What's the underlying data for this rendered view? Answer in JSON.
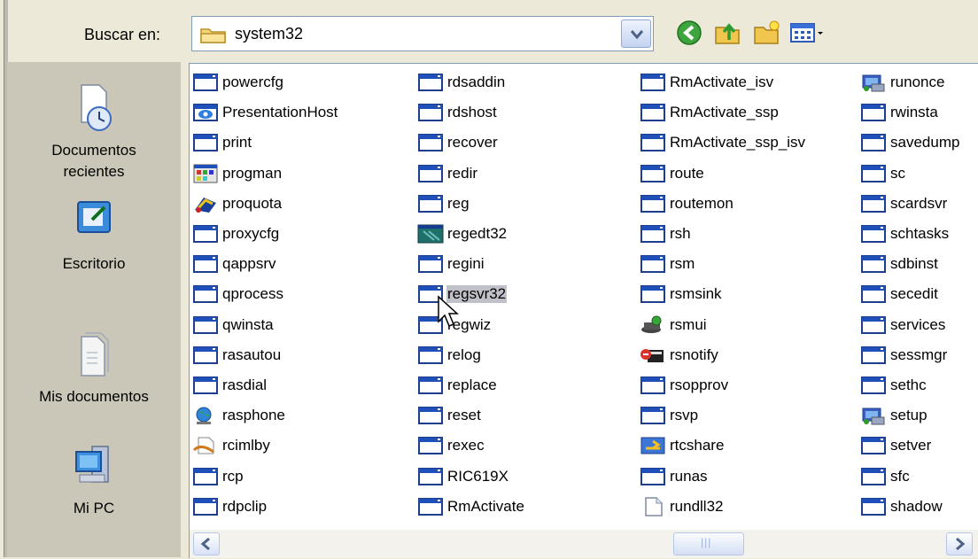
{
  "look_in": {
    "label": "Buscar en:",
    "value": "system32"
  },
  "toolbar": {
    "back_icon": "back-icon",
    "up_icon": "up-folder-icon",
    "new_folder_icon": "new-folder-icon",
    "views_icon": "views-menu-icon"
  },
  "places": [
    {
      "label1": "Documentos",
      "label2": "recientes",
      "icon": "recent-documents-icon"
    },
    {
      "label1": "Escritorio",
      "label2": "",
      "icon": "desktop-icon"
    },
    {
      "label1": "Mis documentos",
      "label2": "",
      "icon": "my-documents-icon"
    },
    {
      "label1": "Mi PC",
      "label2": "",
      "icon": "my-computer-icon"
    }
  ],
  "columns": [
    [
      {
        "name": "powercfg",
        "icon": "exe"
      },
      {
        "name": "PresentationHost",
        "icon": "presentation"
      },
      {
        "name": "print",
        "icon": "exe"
      },
      {
        "name": "progman",
        "icon": "progman"
      },
      {
        "name": "proquota",
        "icon": "proquota"
      },
      {
        "name": "proxycfg",
        "icon": "exe"
      },
      {
        "name": "qappsrv",
        "icon": "exe"
      },
      {
        "name": "qprocess",
        "icon": "exe"
      },
      {
        "name": "qwinsta",
        "icon": "exe"
      },
      {
        "name": "rasautou",
        "icon": "exe"
      },
      {
        "name": "rasdial",
        "icon": "exe"
      },
      {
        "name": "rasphone",
        "icon": "globe"
      },
      {
        "name": "rcimlby",
        "icon": "rcimlby"
      },
      {
        "name": "rcp",
        "icon": "exe"
      },
      {
        "name": "rdpclip",
        "icon": "exe"
      }
    ],
    [
      {
        "name": "rdsaddin",
        "icon": "exe"
      },
      {
        "name": "rdshost",
        "icon": "exe"
      },
      {
        "name": "recover",
        "icon": "exe"
      },
      {
        "name": "redir",
        "icon": "exe"
      },
      {
        "name": "reg",
        "icon": "exe"
      },
      {
        "name": "regedt32",
        "icon": "regedit"
      },
      {
        "name": "regini",
        "icon": "exe"
      },
      {
        "name": "regsvr32",
        "icon": "exe",
        "selected": true
      },
      {
        "name": "regwiz",
        "icon": "exe"
      },
      {
        "name": "relog",
        "icon": "exe"
      },
      {
        "name": "replace",
        "icon": "exe"
      },
      {
        "name": "reset",
        "icon": "exe"
      },
      {
        "name": "rexec",
        "icon": "exe"
      },
      {
        "name": "RIC619X",
        "icon": "exe"
      },
      {
        "name": "RmActivate",
        "icon": "exe"
      }
    ],
    [
      {
        "name": "RmActivate_isv",
        "icon": "exe"
      },
      {
        "name": "RmActivate_ssp",
        "icon": "exe"
      },
      {
        "name": "RmActivate_ssp_isv",
        "icon": "exe"
      },
      {
        "name": "route",
        "icon": "exe"
      },
      {
        "name": "routemon",
        "icon": "exe"
      },
      {
        "name": "rsh",
        "icon": "exe"
      },
      {
        "name": "rsm",
        "icon": "exe"
      },
      {
        "name": "rsmsink",
        "icon": "exe"
      },
      {
        "name": "rsmui",
        "icon": "rsmui"
      },
      {
        "name": "rsnotify",
        "icon": "rsnotify"
      },
      {
        "name": "rsopprov",
        "icon": "exe"
      },
      {
        "name": "rsvp",
        "icon": "exe"
      },
      {
        "name": "rtcshare",
        "icon": "rtcshare"
      },
      {
        "name": "runas",
        "icon": "exe"
      },
      {
        "name": "rundll32",
        "icon": "doc"
      }
    ],
    [
      {
        "name": "runonce",
        "icon": "setup"
      },
      {
        "name": "rwinsta",
        "icon": "exe"
      },
      {
        "name": "savedump",
        "icon": "exe"
      },
      {
        "name": "sc",
        "icon": "exe"
      },
      {
        "name": "scardsvr",
        "icon": "exe"
      },
      {
        "name": "schtasks",
        "icon": "exe"
      },
      {
        "name": "sdbinst",
        "icon": "exe"
      },
      {
        "name": "secedit",
        "icon": "exe"
      },
      {
        "name": "services",
        "icon": "exe"
      },
      {
        "name": "sessmgr",
        "icon": "exe"
      },
      {
        "name": "sethc",
        "icon": "exe"
      },
      {
        "name": "setup",
        "icon": "setup"
      },
      {
        "name": "setver",
        "icon": "exe"
      },
      {
        "name": "sfc",
        "icon": "exe"
      },
      {
        "name": "shadow",
        "icon": "exe"
      }
    ]
  ],
  "scrollbar": {
    "left_arrow_icon": "scroll-left-icon",
    "right_arrow_icon": "scroll-right-icon",
    "thumb_grip": "|||",
    "position": 0.62
  }
}
